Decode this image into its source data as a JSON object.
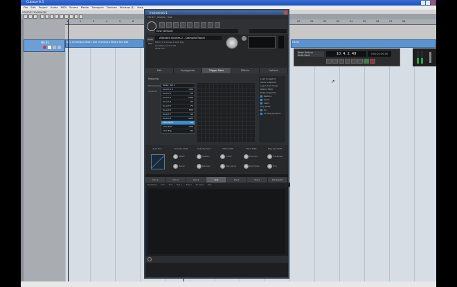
{
  "app": {
    "title": "Cubase 6.5",
    "menu": [
      "File",
      "Edit",
      "Project",
      "Audio",
      "MIDI",
      "Scores",
      "Media",
      "Transport",
      "Devices",
      "Window (1)",
      "Help"
    ],
    "project_title": "cosmic review.cpr"
  },
  "ruler": {
    "bars": [
      "1",
      "2",
      "3",
      "4",
      "5",
      "6",
      "7",
      "8",
      "9",
      "10",
      "11",
      "12",
      "13",
      "14",
      "15",
      "16",
      "17",
      "18",
      "19",
      "20",
      "21",
      "22",
      "23",
      "24",
      "25",
      "26",
      "27",
      "28"
    ]
  },
  "track": {
    "name": "HS 01"
  },
  "events": {
    "event1_label": "001 Orchestra Mix01 002 Orchestra Mix01 Mix Edit",
    "event2_label": "HS 01"
  },
  "transport": {
    "mode_line1": "Keep History",
    "mode_line2": "Auto-Fade",
    "position": "10. 4. 2. 49",
    "time": "0:00:21:00.00"
  },
  "plugin": {
    "window_title": "Instrument 1",
    "strip_text": "HS 01 · Inserts · Inst",
    "program_name": "New (default)",
    "master_tag": "Multi Slot",
    "slot_num": "1",
    "slot_name": "Ambient Drones 2 - Damped Room",
    "slot_info": [
      "MIDI Ch  1   Voices  0   A01  Poly",
      "Out  Main   Level 0.00",
      "Mute  Solo"
    ],
    "tabs": [
      "Edit",
      "Arpeggiator",
      "Trigger Pads",
      "Effects",
      "Options"
    ],
    "active_tab": "Trigger Pads",
    "mapping_label": "Mapping",
    "side_labels": [
      "Performance",
      "Controls"
    ],
    "trig_list": [
      {
        "name": "Swap: Set 1",
        "val": ""
      },
      {
        "name": "Sound 1 b",
        "val": "C#0"
      },
      {
        "name": "Sound 2",
        "val": "D0"
      },
      {
        "name": "Sound 3",
        "val": "D#0"
      },
      {
        "name": "Sound 4",
        "val": "E0"
      },
      {
        "name": "Sound 5",
        "val": "F0"
      },
      {
        "name": "Sound 6",
        "val": "F#0"
      },
      {
        "name": "Sound 7",
        "val": "G0"
      },
      {
        "name": "Sound 8",
        "val": "G#0"
      },
      {
        "name": "Lead Note",
        "val": "A0"
      },
      {
        "name": "Low Note",
        "val": "A#0"
      },
      {
        "name": "Last Trig",
        "val": "B0"
      }
    ],
    "right_panel": [
      "Load Snapshot",
      "Store Snapshot",
      "Learn from Song",
      "Option MIDI",
      "",
      "Mute Snapshot",
      "Restore",
      "Cycle",
      "Learn",
      "",
      "Key Swap",
      "On",
      "CC Key Dynamic"
    ],
    "param_groups": [
      "Amp Env",
      "Velocity Shift",
      "Velocity Sens",
      "Filter Shift",
      "Pitch Shift",
      "Play Key Shift"
    ],
    "knob_labels": [
      "Attack",
      "Decay",
      "Sustain",
      "Release",
      "Cutoff",
      "Resonance",
      "Env Amt",
      "Key Follow",
      "Transpose",
      "Fine",
      "Pan",
      "Volume"
    ],
    "bottom_tabs": [
      "Ctrl 1",
      "Ctrl 2",
      "Ctrl 3",
      "Slot",
      "Prg 1",
      "Prg 2",
      "Prg Switch"
    ],
    "active_bottom_tab": "Slot",
    "bottom_strip": [
      "Prg Name",
      "Ctrl",
      "Slot",
      "Bus 1",
      "Bus 2",
      "FX Send",
      "Out"
    ]
  }
}
